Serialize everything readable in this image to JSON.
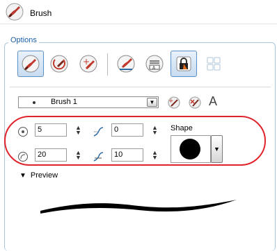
{
  "header": {
    "title": "Brush"
  },
  "options": {
    "label": "Options",
    "preset": {
      "name": "Brush 1",
      "font_glyph": "A"
    },
    "size_min": "5",
    "size_max": "20",
    "smoothing": "0",
    "contour_smoothing": "10",
    "shape_label": "Shape",
    "shape_value": "round"
  },
  "preview": {
    "label": "Preview",
    "expanded": true
  },
  "colors": {
    "accent": "#1c5fa8",
    "highlight": "#e0232b"
  }
}
